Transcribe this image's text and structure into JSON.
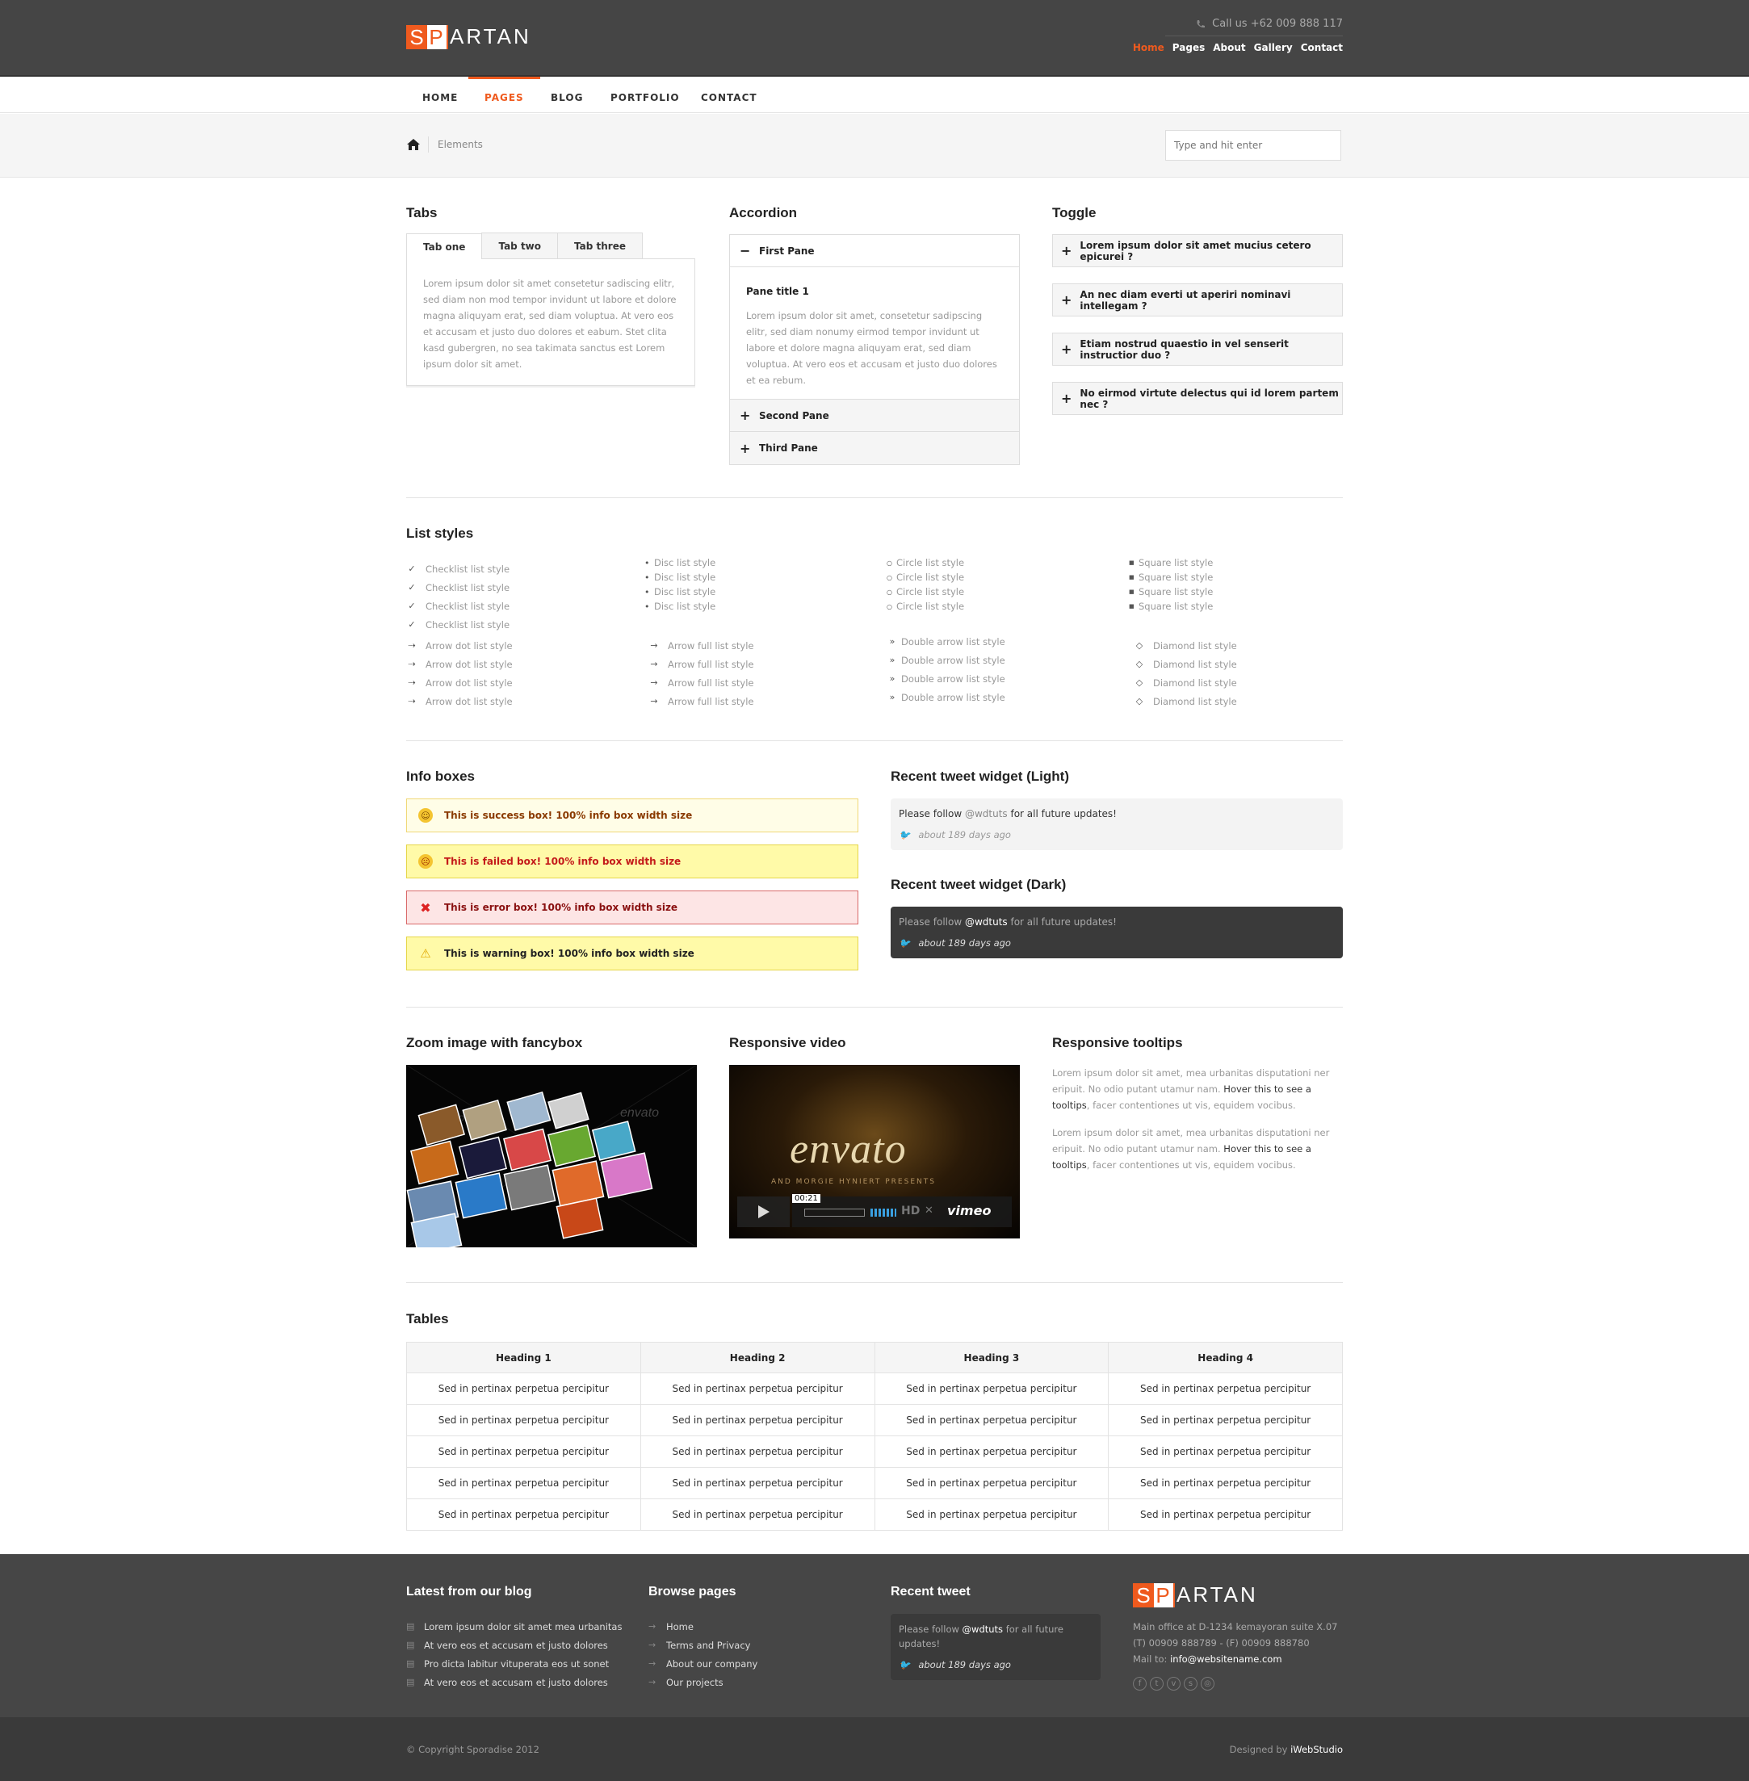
{
  "header": {
    "logo": {
      "a": "S",
      "b": "P",
      "rest": "ARTAN"
    },
    "phone": "Call us +62 009 888 117",
    "topnav": [
      "Home",
      "Pages",
      "About",
      "Gallery",
      "Contact"
    ],
    "accent": "#ef5a1e"
  },
  "mainnav": [
    "HOME",
    "PAGES",
    "BLOG",
    "PORTFOLIO",
    "CONTACT"
  ],
  "breadcrumb": {
    "current": "Elements",
    "search_placeholder": "Type and hit enter"
  },
  "tabs": {
    "title": "Tabs",
    "items": [
      "Tab one",
      "Tab two",
      "Tab three"
    ],
    "content": "Lorem ipsum dolor sit amet consetetur sadiscing elitr, sed diam non mod tempor invidunt ut labore et dolore magna aliquyam erat, sed diam voluptua. At vero eos et accusam et justo duo dolores et eabum. Stet clita kasd gubergren, no sea takimata sanctus est Lorem ipsum dolor sit amet."
  },
  "accordion": {
    "title": "Accordion",
    "panes": [
      "First Pane",
      "Second Pane",
      "Third Pane"
    ],
    "pane_title": "Pane title 1",
    "pane_text": "Lorem ipsum dolor sit amet, consetetur sadipscing elitr, sed diam nonumy eirmod tempor invidunt ut labore et dolore magna aliquyam erat, sed diam voluptua. At vero eos et accusam et justo duo dolores et ea rebum."
  },
  "toggle": {
    "title": "Toggle",
    "items": [
      "Lorem ipsum dolor sit amet mucius cetero epicurei ?",
      "An nec diam everti ut aperiri nominavi intellegam ?",
      "Etiam nostrud quaestio in vel senserit instructior duo ?",
      "No eirmod virtute delectus qui id lorem partem nec ?"
    ]
  },
  "lists": {
    "title": "List styles",
    "checklist": "Checklist list style",
    "disc": "Disc list style",
    "circle": "Circle list style",
    "square": "Square list style",
    "arrow_dot": "Arrow dot list style",
    "arrow_full": "Arrow full list style",
    "double_arrow": "Double arrow list style",
    "diamond": "Diamond list style"
  },
  "info": {
    "title": "Info boxes",
    "success": "This is success box! 100% info box width size",
    "failed": "This is failed box! 100% info box width size",
    "error": "This is error box! 100% info box width size",
    "warning": "This is warning box! 100% info box width size"
  },
  "tweet_light": {
    "title": "Recent tweet widget (Light)",
    "pre": "Please follow ",
    "handle": "@wdtuts",
    "post": " for all future updates!",
    "time": "about 189 days ago"
  },
  "tweet_dark": {
    "title": "Recent tweet widget (Dark)",
    "pre": "Please follow ",
    "handle": "@wdtuts",
    "post": " for all future updates!",
    "time": "about 189 days ago"
  },
  "media": {
    "zoom_title": "Zoom image with fancybox",
    "video_title": "Responsive video",
    "video_brand": "envato",
    "video_sub": "AND MORGIE HYNIERT PRESENTS",
    "video_time": "00:21",
    "video_hd": "HD",
    "video_vimeo": "vimeo",
    "watermark": "envato"
  },
  "tooltips": {
    "title": "Responsive tooltips",
    "p_pre": "Lorem ipsum dolor sit amet, mea urbanitas disputationi ner eripuit. No odio putant utamur nam. ",
    "p_hl": "Hover this to see a tooltips",
    "p_post": ", facer contentiones ut vis, equidem vocibus."
  },
  "table": {
    "title": "Tables",
    "headers": [
      "Heading 1",
      "Heading 2",
      "Heading 3",
      "Heading 4"
    ],
    "cell": "Sed in pertinax perpetua percipitur"
  },
  "footer": {
    "blog_title": "Latest from our blog",
    "blog_items": [
      "Lorem ipsum dolor sit amet mea urbanitas",
      "At vero eos et accusam et justo dolores",
      "Pro dicta labitur vituperata eos ut sonet",
      "At vero eos et accusam et justo dolores"
    ],
    "browse_title": "Browse pages",
    "browse_items": [
      "Home",
      "Terms and Privacy",
      "About our company",
      "Our projects"
    ],
    "tweet_title": "Recent tweet",
    "tweet_pre": "Please follow ",
    "tweet_handle": "@wdtuts",
    "tweet_post": " for all future updates!",
    "tweet_time": "about 189 days ago",
    "address": "Main office at D-1234 kemayoran suite X.07",
    "phone": "(T) 00909 888789 - (F) 00909 888780",
    "mail_label": "Mail to: ",
    "mail": "info@websitename.com",
    "copyright": "© Copyright Sporadise 2012",
    "designed_pre": "Designed by ",
    "designed_by": "iWebStudio"
  }
}
